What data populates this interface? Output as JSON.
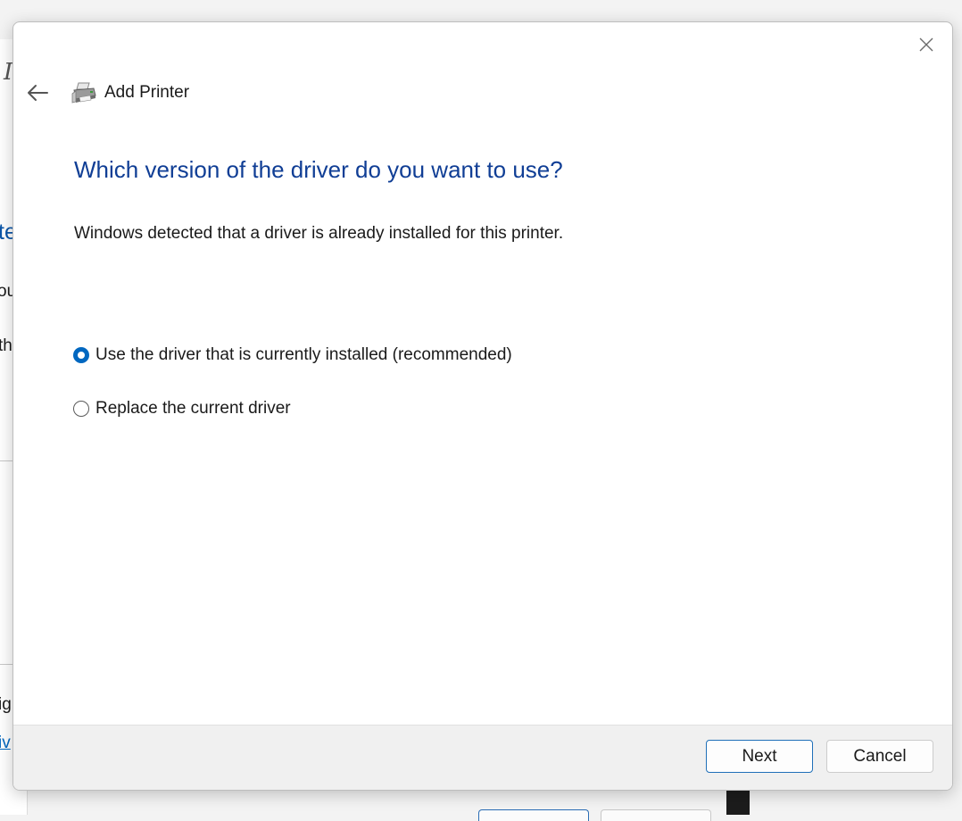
{
  "background": {
    "fragments": [
      "I",
      "te",
      "ou",
      "th",
      "ig",
      "iv"
    ]
  },
  "dialog": {
    "title": "Add Printer",
    "heading": "Which version of the driver do you want to use?",
    "description": "Windows detected that a driver is already installed for this printer.",
    "options": [
      {
        "label": "Use the driver that is currently installed (recommended)",
        "checked": true
      },
      {
        "label": "Replace the current driver",
        "checked": false
      }
    ],
    "buttons": {
      "next": "Next",
      "cancel": "Cancel"
    },
    "icons": {
      "close": "close-icon",
      "back": "back-arrow-icon",
      "printer": "printer-icon"
    },
    "colors": {
      "heading": "#103e95",
      "accent": "#0067c0"
    }
  }
}
